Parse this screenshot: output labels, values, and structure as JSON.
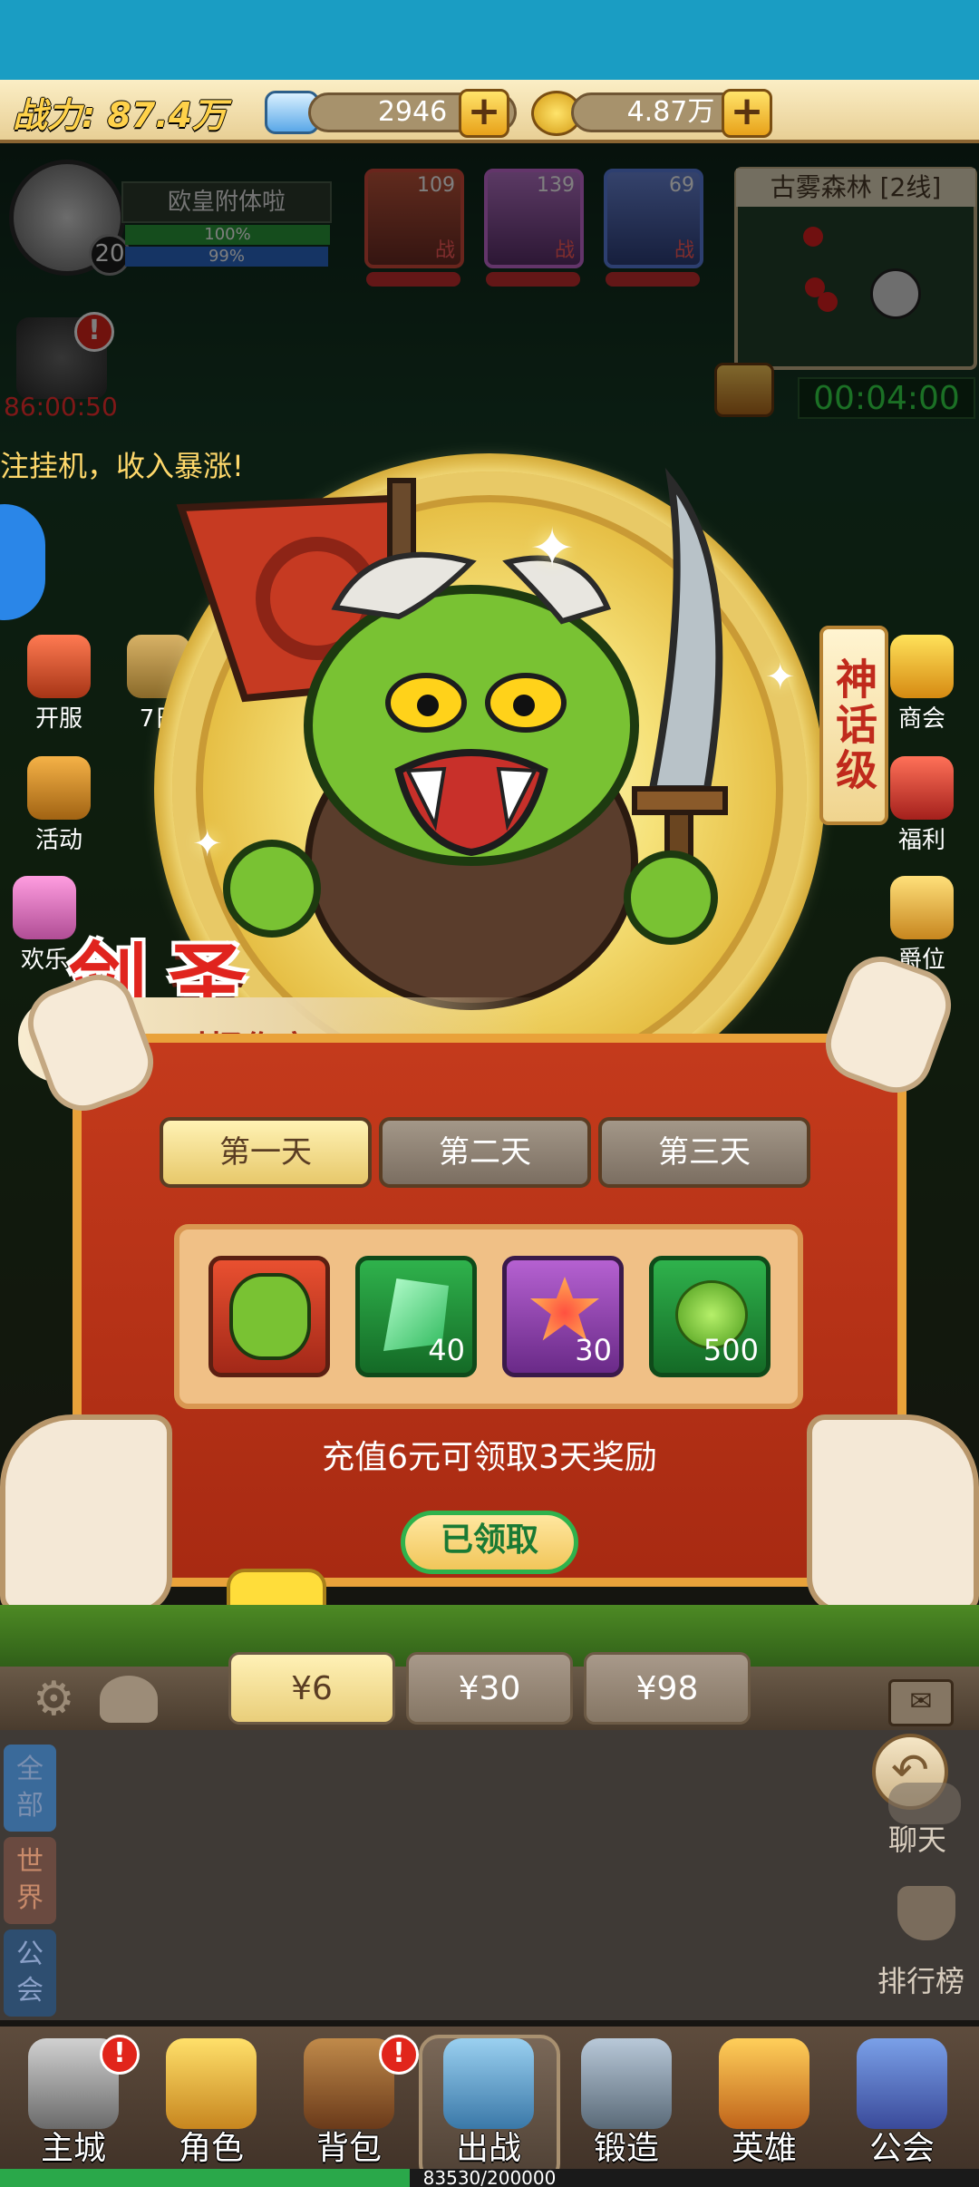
{
  "top": {
    "power_label": "战力: 87.4万",
    "gems": "2946",
    "gold": "4.87万",
    "player_name": "欧皇附体啦",
    "level": "20",
    "hp_pct": "100%",
    "exp_pct": "99%",
    "hero_levels": [
      "109",
      "139",
      "69"
    ],
    "hero_tag": "战",
    "map_title": "古雾森林 [2线]",
    "timer": "00:04:00",
    "event_timer": "86:00:50",
    "ticker": "注挂机，收入暴涨!"
  },
  "side_left": [
    "开服",
    "7日",
    "活动",
    "欢乐"
  ],
  "side_right": [
    "商会",
    "福利",
    "爵位"
  ],
  "dialog": {
    "tier": "神话级",
    "hero_name": "剑圣",
    "passive": "被动: 对怪伤害+50%",
    "tabs": [
      "第一天",
      "第二天",
      "第三天"
    ],
    "rewards": [
      {
        "icon": "orc-hero-icon",
        "count": ""
      },
      {
        "icon": "green-crystal-icon",
        "count": "40"
      },
      {
        "icon": "star-medal-icon",
        "count": "30"
      },
      {
        "icon": "green-fruit-icon",
        "count": "500"
      }
    ],
    "note": "充值6元可领取3天奖励",
    "claimed_label": "已领取",
    "prices": [
      "¥6",
      "¥30",
      "¥98"
    ]
  },
  "chat": {
    "tabs": [
      "全部",
      "世界",
      "公会"
    ],
    "chat_label": "聊天",
    "rank_label": "排行榜"
  },
  "nav": {
    "items": [
      "主城",
      "角色",
      "背包",
      "出战",
      "锻造",
      "英雄",
      "公会"
    ],
    "exp_text": "83530/200000"
  },
  "colors": {
    "accent": "#e9a23a",
    "panel": "#b8321a",
    "claimed": "#2fb24c"
  }
}
